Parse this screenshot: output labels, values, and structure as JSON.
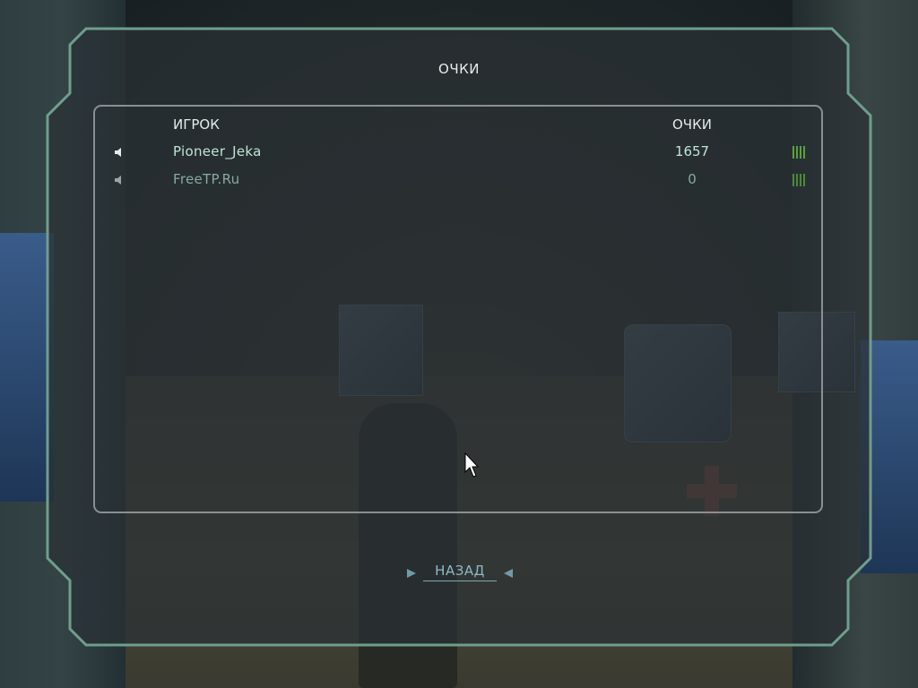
{
  "panel": {
    "title": "ОЧКИ"
  },
  "table": {
    "columns": {
      "player": "ИГРОК",
      "score": "ОЧКИ"
    },
    "rows": [
      {
        "name": "Pioneer_Jeka",
        "score": "1657",
        "voice_icon": "speaker-icon",
        "ping_icon": "ping-bars-icon"
      },
      {
        "name": "FreeTP.Ru",
        "score": "0",
        "voice_icon": "speaker-icon",
        "ping_icon": "ping-bars-icon"
      }
    ]
  },
  "back_button": {
    "label": "НАЗАД"
  },
  "colors": {
    "frame_border": "#6f9e8c",
    "panel_fill": "#2a3134",
    "player_name_active": "#bfe6d4",
    "player_name_dim": "#86aaa0",
    "ping_green": "#5aa23a",
    "back_label": "#8fb8c6"
  }
}
